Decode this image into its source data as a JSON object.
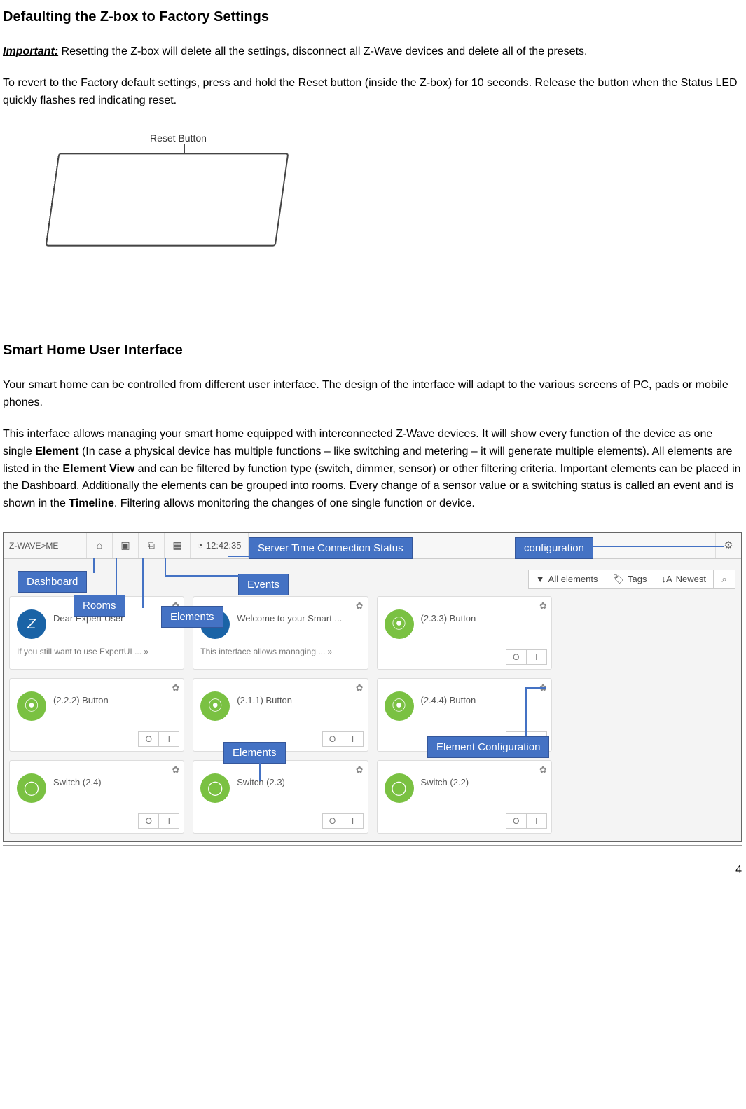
{
  "section1_title": "Defaulting the Z-box to Factory Settings",
  "important_label": "Important:",
  "important_text": " Resetting the Z-box will delete all the settings, disconnect all Z-Wave devices and delete all of the presets.",
  "factory_text": "To revert to the Factory default settings, press and hold the Reset button  (inside the Z-box) for 10 seconds. Release the button  when the Status LED quickly flashes red indicating  reset.",
  "figure_callout": "Reset  Button",
  "section2_title": "Smart Home User Interface",
  "intro_text": "Your smart home can be controlled from different user interface. The design of the interface will adapt to the various screens of PC, pads or mobile phones.",
  "para2_a": "This interface allows managing your smart home equipped with interconnected Z-Wave devices. It will show every function of the device as one single ",
  "para2_element": "Element",
  "para2_b": " (In case a physical device has multiple functions – like switching and metering – it will generate multiple elements). All elements are listed in the ",
  "para2_elementview": "Element View",
  "para2_c": " and can be filtered by function type (switch, dimmer, sensor) or other filtering criteria. Important elements can be placed in the Dashboard. Additionally the elements can be grouped into rooms. Every change of a sensor value or a switching status is called an event and is shown in the ",
  "para2_timeline": "Timeline",
  "para2_d": ".  Filtering allows monitoring the changes of one single function or device.",
  "toolbar": {
    "brand": "Z-WAVE>ME",
    "clock": "12:42:35"
  },
  "filterbar": {
    "all": "All elements",
    "tags": "Tags",
    "newest": "Newest"
  },
  "cards": [
    {
      "icon": "z",
      "title": "Dear Expert User",
      "sub": "If you still want to use ExpertUI ... »",
      "toggle": false
    },
    {
      "icon": "z",
      "title": "Welcome to your Smart ...",
      "sub": "This interface allows managing ... »",
      "toggle": false
    },
    {
      "icon": "btn",
      "title": "(2.3.3) Button",
      "sub": "",
      "toggle": true
    },
    {},
    {
      "icon": "btn",
      "title": "(2.2.2) Button",
      "sub": "",
      "toggle": true
    },
    {
      "icon": "btn",
      "title": "(2.1.1) Button",
      "sub": "",
      "toggle": true
    },
    {
      "icon": "btn",
      "title": "(2.4.4) Button",
      "sub": "",
      "toggle": true
    },
    {},
    {
      "icon": "sw",
      "title": "Switch (2.4)",
      "sub": "",
      "toggle": true
    },
    {
      "icon": "sw",
      "title": "Switch (2.3)",
      "sub": "",
      "toggle": true
    },
    {
      "icon": "sw",
      "title": "Switch (2.2)",
      "sub": "",
      "toggle": true
    },
    {}
  ],
  "toggle_labels": {
    "o": "O",
    "i": "I"
  },
  "anno": {
    "server_time": "Server Time Connection Status",
    "configuration": "configuration",
    "dashboard": "Dashboard",
    "rooms": "Rooms",
    "elements1": "Elements",
    "events": "Events",
    "elements2": "Elements",
    "elem_config": "Element Configuration"
  },
  "page_number": "4"
}
